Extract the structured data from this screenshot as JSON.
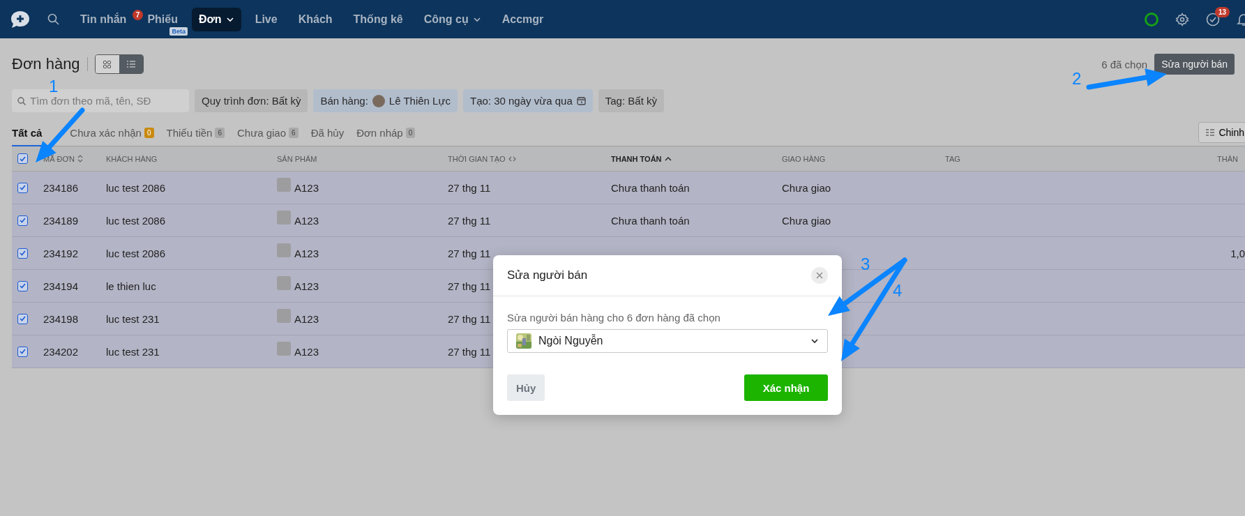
{
  "nav": {
    "items": [
      {
        "label": "Tin nhắn",
        "selected": false,
        "badge": "7"
      },
      {
        "label": "Phiếu",
        "selected": false,
        "tag": "Beta"
      },
      {
        "label": "Đơn",
        "selected": true,
        "dropdown": true
      },
      {
        "label": "Live",
        "selected": false
      },
      {
        "label": "Khách",
        "selected": false
      },
      {
        "label": "Thống kê",
        "selected": false
      },
      {
        "label": "Công cụ",
        "selected": false,
        "dropdown": true
      },
      {
        "label": "Accmgr",
        "selected": false
      }
    ],
    "online": true,
    "tasks_badge": "13"
  },
  "page": {
    "title": "Đơn hàng",
    "views": [
      {
        "kind": "grid",
        "selected": false
      },
      {
        "kind": "list",
        "selected": true
      }
    ],
    "selection_count": "6 đã chọn",
    "action_button": "Sửa người bán"
  },
  "filters": {
    "search_placeholder": "Tìm đơn theo mã, tên, SĐ",
    "chips": [
      {
        "kind": "plain",
        "label": "Quy trình đơn: Bất kỳ",
        "active": false
      },
      {
        "kind": "person",
        "label": "Bán hàng:",
        "value": "Lê Thiên Lực",
        "active": true
      },
      {
        "kind": "date",
        "label": "Tạo: 30 ngày vừa qua",
        "active": true
      },
      {
        "kind": "plain",
        "label": "Tag: Bất kỳ",
        "active": false
      }
    ]
  },
  "tabs": [
    {
      "label": "Tất cả",
      "selected": true
    },
    {
      "label": "Chưa xác nhận",
      "selected": false,
      "count": "0",
      "highlight": true
    },
    {
      "label": "Thiếu tiền",
      "selected": false,
      "count": "6",
      "highlight": false
    },
    {
      "label": "Chưa giao",
      "selected": false,
      "count": "6",
      "highlight": false
    },
    {
      "label": "Đã hủy",
      "selected": false
    },
    {
      "label": "Đơn nháp",
      "selected": false,
      "count": "0",
      "highlight": false
    }
  ],
  "columns_button": "Chinh",
  "table": {
    "all_checked": true,
    "columns": [
      {
        "label": "MÃ ĐƠN",
        "kind": "sortable"
      },
      {
        "label": "KHÁCH HÀNG",
        "kind": "plain"
      },
      {
        "label": "SẢN PHẨM",
        "kind": "plain"
      },
      {
        "label": "THỜI GIAN TẠO",
        "kind": "range"
      },
      {
        "label": "THANH TOÁN",
        "kind": "sorted"
      },
      {
        "label": "GIAO HÀNG",
        "kind": "plain"
      },
      {
        "label": "TAG",
        "kind": "plain"
      },
      {
        "label": "THÀN",
        "kind": "plain"
      }
    ],
    "rows": [
      {
        "checked": true,
        "order": "234186",
        "customer": "luc test 2086",
        "product": "A123",
        "created": "27 thg 11",
        "payment": "Chưa thanh toán",
        "delivery": "Chưa giao"
      },
      {
        "checked": true,
        "order": "234189",
        "customer": "luc test 2086",
        "product": "A123",
        "created": "27 thg 11",
        "payment": "Chưa thanh toán",
        "delivery": "Chưa giao"
      },
      {
        "checked": true,
        "order": "234192",
        "customer": "luc test 2086",
        "product": "A123",
        "created": "27 thg 11",
        "column_8": "1,0"
      },
      {
        "checked": true,
        "order": "234194",
        "customer": "le thien luc",
        "product": "A123",
        "created": "27 thg 11"
      },
      {
        "checked": true,
        "order": "234198",
        "customer": "luc test 231",
        "product": "A123",
        "created": "27 thg 11"
      },
      {
        "checked": true,
        "order": "234202",
        "customer": "luc test 231",
        "product": "A123",
        "created": "27 thg 11"
      }
    ]
  },
  "dialog": {
    "title": "Sửa người bán",
    "label": "Sửa người bán hàng cho 6 đơn hàng đã chọn",
    "selected_seller": "Ngòi Nguyễn",
    "cancel": "Hủy",
    "confirm": "Xác nhận"
  },
  "annotations": [
    {
      "label": "1"
    },
    {
      "label": "2"
    },
    {
      "label": "3"
    },
    {
      "label": "4"
    }
  ]
}
